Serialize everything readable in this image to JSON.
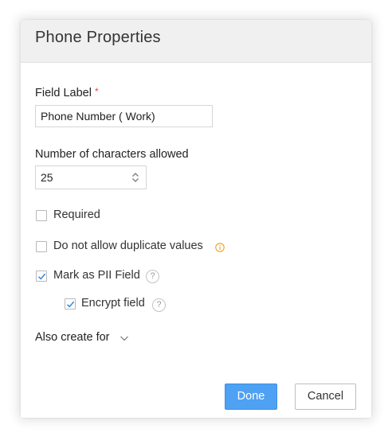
{
  "dialog": {
    "title": "Phone Properties",
    "field_label": {
      "label": "Field Label",
      "required_mark": "*",
      "value": "Phone Number ( Work)"
    },
    "char_limit": {
      "label": "Number of characters allowed",
      "value": "25"
    },
    "options": [
      {
        "label": "Required",
        "checked": false
      },
      {
        "label": "Do not allow duplicate values",
        "checked": false,
        "icon": "info-icon"
      },
      {
        "label": "Mark as PII Field",
        "checked": true,
        "icon": "help-icon",
        "icon_glyph": "?"
      },
      {
        "label": "Encrypt field",
        "checked": true,
        "icon": "help-icon",
        "icon_glyph": "?"
      }
    ],
    "also_create": {
      "label": "Also create for",
      "icon": "chevron-down-icon"
    },
    "buttons": {
      "done": "Done",
      "cancel": "Cancel"
    }
  },
  "colors": {
    "primary_button": "#4ea1f3",
    "required_star": "#e8473f",
    "checkmark": "#3b8fe0",
    "info_icon": "#f0a020",
    "header_bg": "#f0f0f0"
  }
}
